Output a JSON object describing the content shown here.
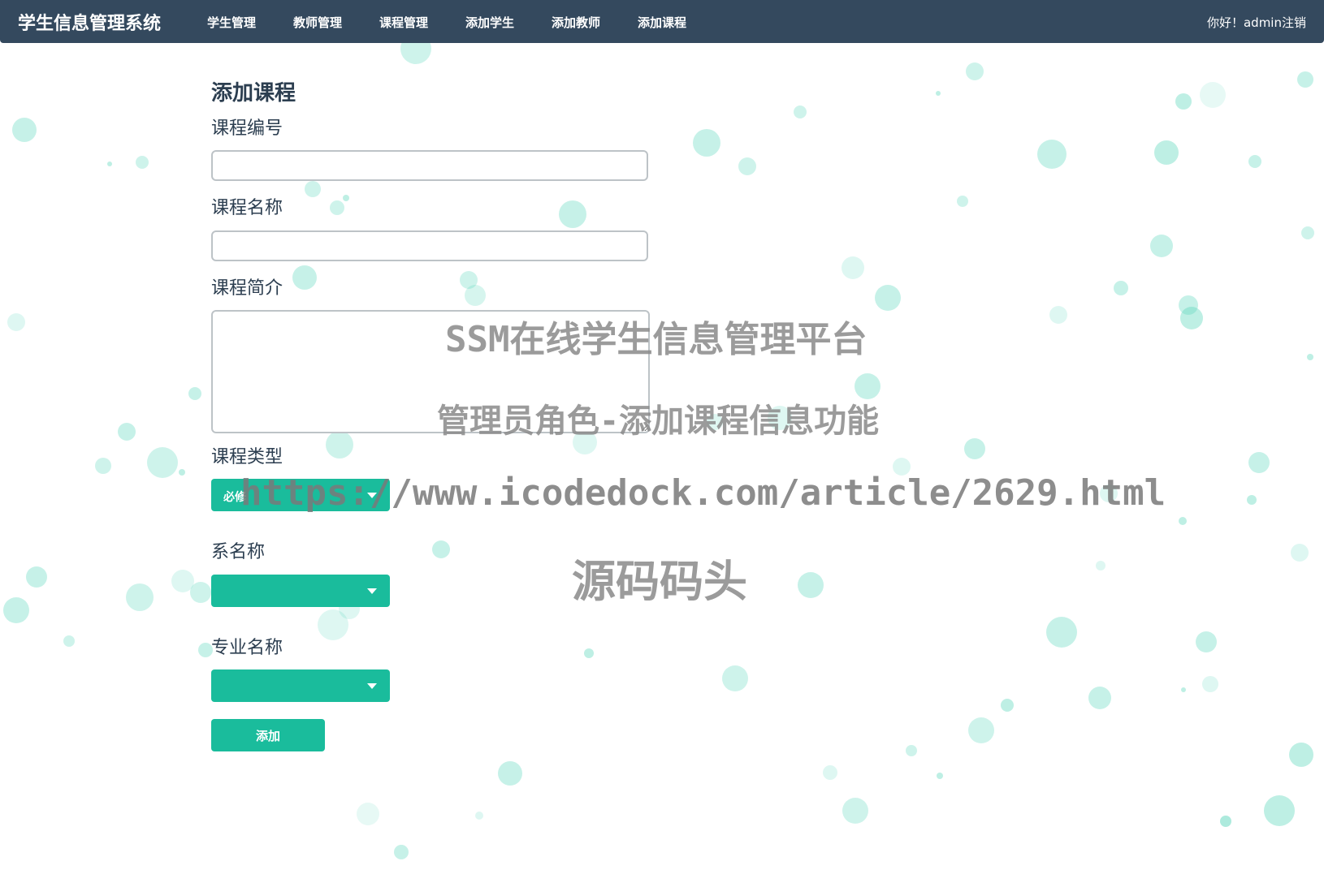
{
  "brand": "学生信息管理系统",
  "nav": {
    "items": [
      {
        "label": "学生管理"
      },
      {
        "label": "教师管理"
      },
      {
        "label": "课程管理"
      },
      {
        "label": "添加学生"
      },
      {
        "label": "添加教师"
      },
      {
        "label": "添加课程"
      }
    ],
    "greeting": "你好！admin",
    "logout": "注销"
  },
  "form": {
    "title": "添加课程",
    "course_id_label": "课程编号",
    "course_id_value": "",
    "course_name_label": "课程名称",
    "course_name_value": "",
    "course_intro_label": "课程简介",
    "course_intro_value": "",
    "course_type_label": "课程类型",
    "course_type_value": "必修",
    "dept_label": "系名称",
    "dept_value": "",
    "major_label": "专业名称",
    "major_value": "",
    "submit_label": "添加"
  },
  "watermark": {
    "line1": "SSM在线学生信息管理平台",
    "line2": "管理员角色-添加课程信息功能",
    "line3": "https://www.icodedock.com/article/2629.html",
    "line4": "源码码头"
  },
  "colors": {
    "navbar": "#34495e",
    "accent": "#1abc9c",
    "bubble": "#5cd6bc"
  }
}
